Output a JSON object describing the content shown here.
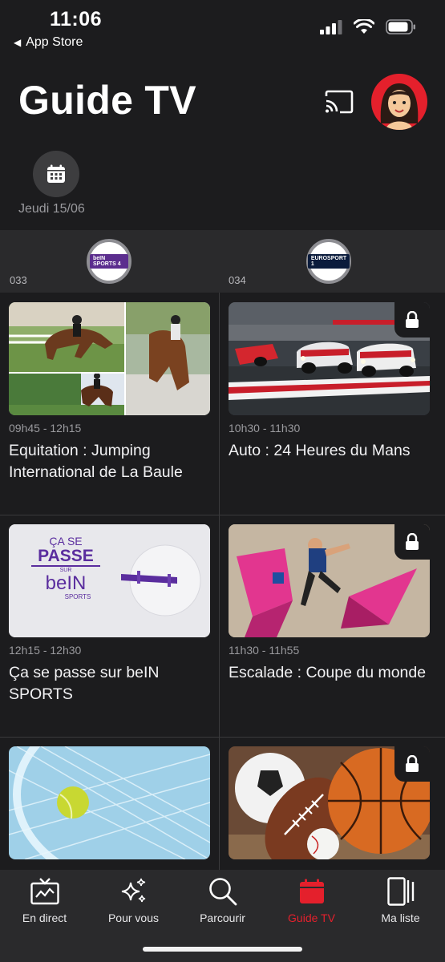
{
  "status_bar": {
    "time": "11:06",
    "back_app": "App Store"
  },
  "header": {
    "title": "Guide TV"
  },
  "date": {
    "label": "Jeudi 15/06"
  },
  "channels": [
    {
      "number": "033",
      "logo_text": "beIN SPORTS 4",
      "logo_color": "#5b2d8e"
    },
    {
      "number": "034",
      "logo_text": "EUROSPORT 1",
      "logo_color": "#0a1b3c"
    }
  ],
  "programs": [
    {
      "time": "09h45 - 12h15",
      "title": "Equitation : Jumping International de La Baule",
      "locked": false
    },
    {
      "time": "10h30 - 11h30",
      "title": "Auto : 24 Heures du Mans",
      "locked": true
    },
    {
      "time": "12h15 - 12h30",
      "title": "Ça se passe sur beIN SPORTS",
      "locked": false,
      "thumb_text": {
        "line1": "ÇA SE",
        "line2": "PASSE",
        "line3": "SUR",
        "brand": "beIN",
        "sub": "SPORTS"
      }
    },
    {
      "time": "11h30 - 11h55",
      "title": "Escalade : Coupe du monde",
      "locked": true
    },
    {
      "time": "",
      "title": "",
      "locked": false
    },
    {
      "time": "",
      "title": "",
      "locked": true
    }
  ],
  "tabs": [
    {
      "label": "En direct",
      "icon": "tv-live-icon"
    },
    {
      "label": "Pour vous",
      "icon": "sparkles-icon"
    },
    {
      "label": "Parcourir",
      "icon": "search-icon"
    },
    {
      "label": "Guide TV",
      "icon": "calendar-icon",
      "active": true
    },
    {
      "label": "Ma liste",
      "icon": "library-icon"
    }
  ],
  "colors": {
    "accent": "#e4202c",
    "background": "#1c1c1e",
    "surface": "#2a2a2c"
  }
}
